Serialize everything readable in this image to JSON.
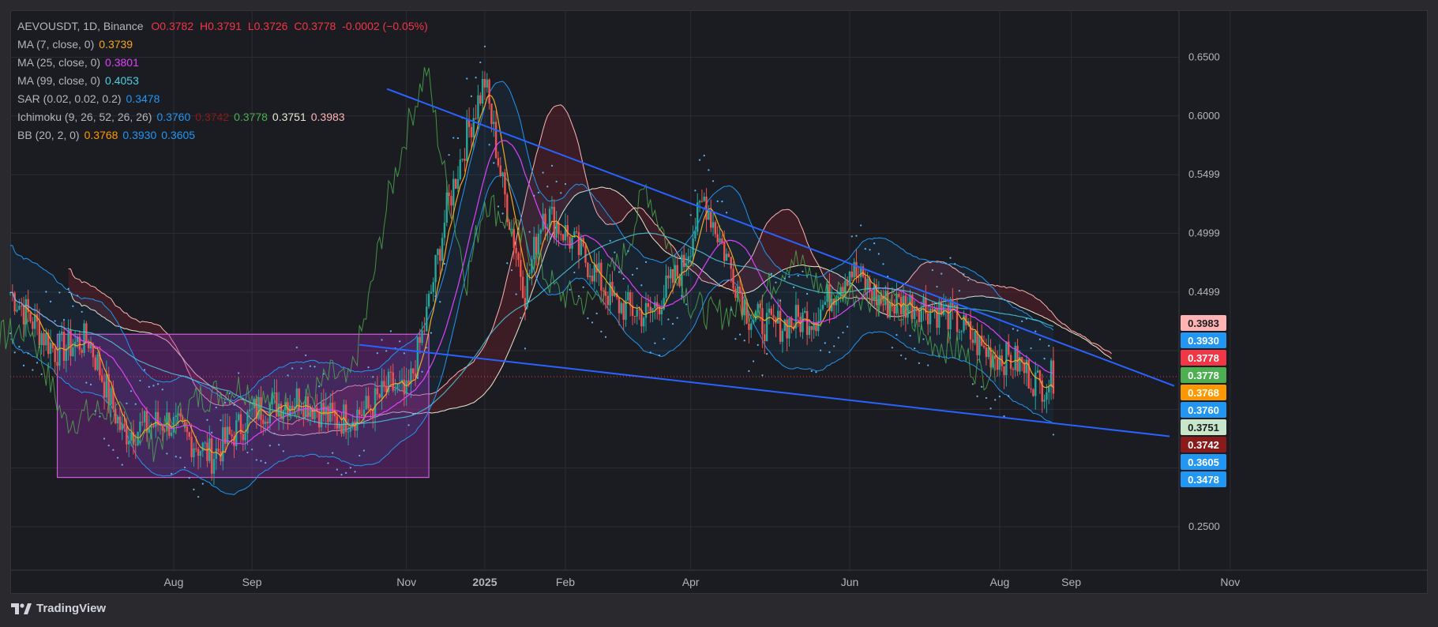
{
  "app": {
    "brand": "TradingView"
  },
  "legend": {
    "symbol": "AEVOUSDT, 1D, Binance",
    "ohlc": {
      "o": "O0.3782",
      "h": "H0.3791",
      "l": "L0.3726",
      "c": "C0.3778",
      "chg": "-0.0002 (−0.05%)"
    },
    "indicators": [
      {
        "label": "MA (7, close, 0)",
        "values": [
          "0.3739"
        ],
        "colors": [
          "#f5a623"
        ]
      },
      {
        "label": "MA (25, close, 0)",
        "values": [
          "0.3801"
        ],
        "colors": [
          "#e040fb"
        ]
      },
      {
        "label": "MA (99, close, 0)",
        "values": [
          "0.4053"
        ],
        "colors": [
          "#4dd0e1"
        ]
      },
      {
        "label": "SAR (0.02, 0.02, 0.2)",
        "values": [
          "0.3478"
        ],
        "colors": [
          "#2196f3"
        ]
      },
      {
        "label": "Ichimoku (9, 26, 52, 26, 26)",
        "values": [
          "0.3760",
          "0.3742",
          "0.3778",
          "0.3751",
          "0.3983"
        ],
        "colors": [
          "#2196f3",
          "#8b1a1a",
          "#4caf50",
          "#e8e8d0",
          "#ffb3b3"
        ]
      },
      {
        "label": "BB (20, 2, 0)",
        "values": [
          "0.3768",
          "0.3930",
          "0.3605"
        ],
        "colors": [
          "#ff9800",
          "#2196f3",
          "#2196f3"
        ]
      }
    ]
  },
  "chart_data": {
    "type": "candlestick",
    "symbol": "AEVOUSDT",
    "interval": "1D",
    "exchange": "Binance",
    "y_ticks": [
      "0.6500",
      "0.6000",
      "0.5499",
      "0.4999",
      "0.4499",
      "0.2500"
    ],
    "x_ticks": [
      "Aug",
      "Sep",
      "Nov",
      "2025",
      "Feb",
      "Apr",
      "Jun",
      "Aug",
      "Sep",
      "Nov"
    ],
    "ylim": [
      0.213,
      0.69
    ],
    "last_price": 0.3778,
    "price_tags": [
      {
        "value": "0.3983",
        "color": "#ffb3b3",
        "text_color": "#1b1c22"
      },
      {
        "value": "0.3930",
        "color": "#2196f3",
        "text_color": "#ffffff"
      },
      {
        "value": "0.3778",
        "color": "#f23645",
        "text_color": "#ffffff"
      },
      {
        "value": "0.3778",
        "color": "#4caf50",
        "text_color": "#ffffff"
      },
      {
        "value": "0.3768",
        "color": "#ff9800",
        "text_color": "#ffffff"
      },
      {
        "value": "0.3760",
        "color": "#2196f3",
        "text_color": "#ffffff"
      },
      {
        "value": "0.3751",
        "color": "#c8e6c9",
        "text_color": "#1b1c22"
      },
      {
        "value": "0.3742",
        "color": "#8b1a1a",
        "text_color": "#ffffff"
      },
      {
        "value": "0.3605",
        "color": "#2196f3",
        "text_color": "#ffffff"
      },
      {
        "value": "0.3478",
        "color": "#2196f3",
        "text_color": "#ffffff"
      }
    ],
    "drawings": {
      "range_box": {
        "color": "#9c27b0",
        "x_span": [
          "mid-Jul 2024",
          "early Nov 2024"
        ],
        "y_span": [
          0.292,
          0.414
        ]
      },
      "resistance_line": {
        "color": "#2962ff",
        "from_value": 0.623,
        "to_value": 0.37
      },
      "support_line": {
        "color": "#2962ff",
        "from_value": 0.405,
        "to_value": 0.327
      }
    },
    "grid": true
  }
}
